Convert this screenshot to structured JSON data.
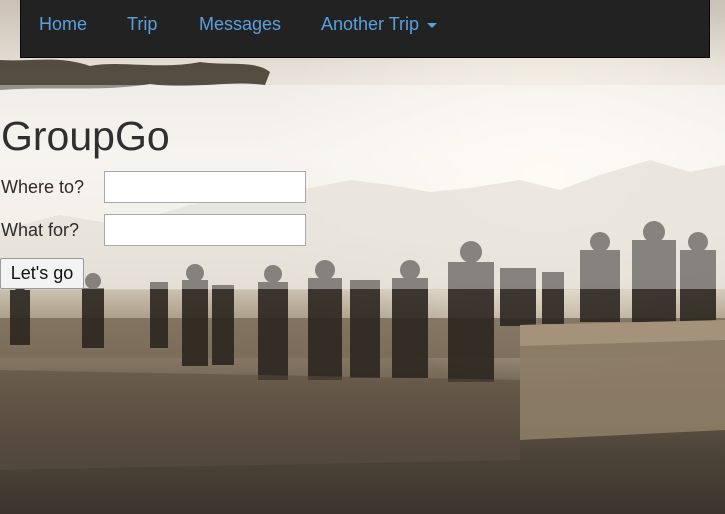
{
  "nav": {
    "home": "Home",
    "trip": "Trip",
    "messages": "Messages",
    "another_trip": "Another Trip"
  },
  "header": {
    "title": "GroupGo"
  },
  "form": {
    "where_label": "Where to?",
    "where_value": "",
    "what_label": "What for?",
    "what_value": "",
    "submit_label": "Let's go"
  },
  "colors": {
    "navbar_bg": "#222222",
    "nav_link": "#5aa0dc"
  }
}
